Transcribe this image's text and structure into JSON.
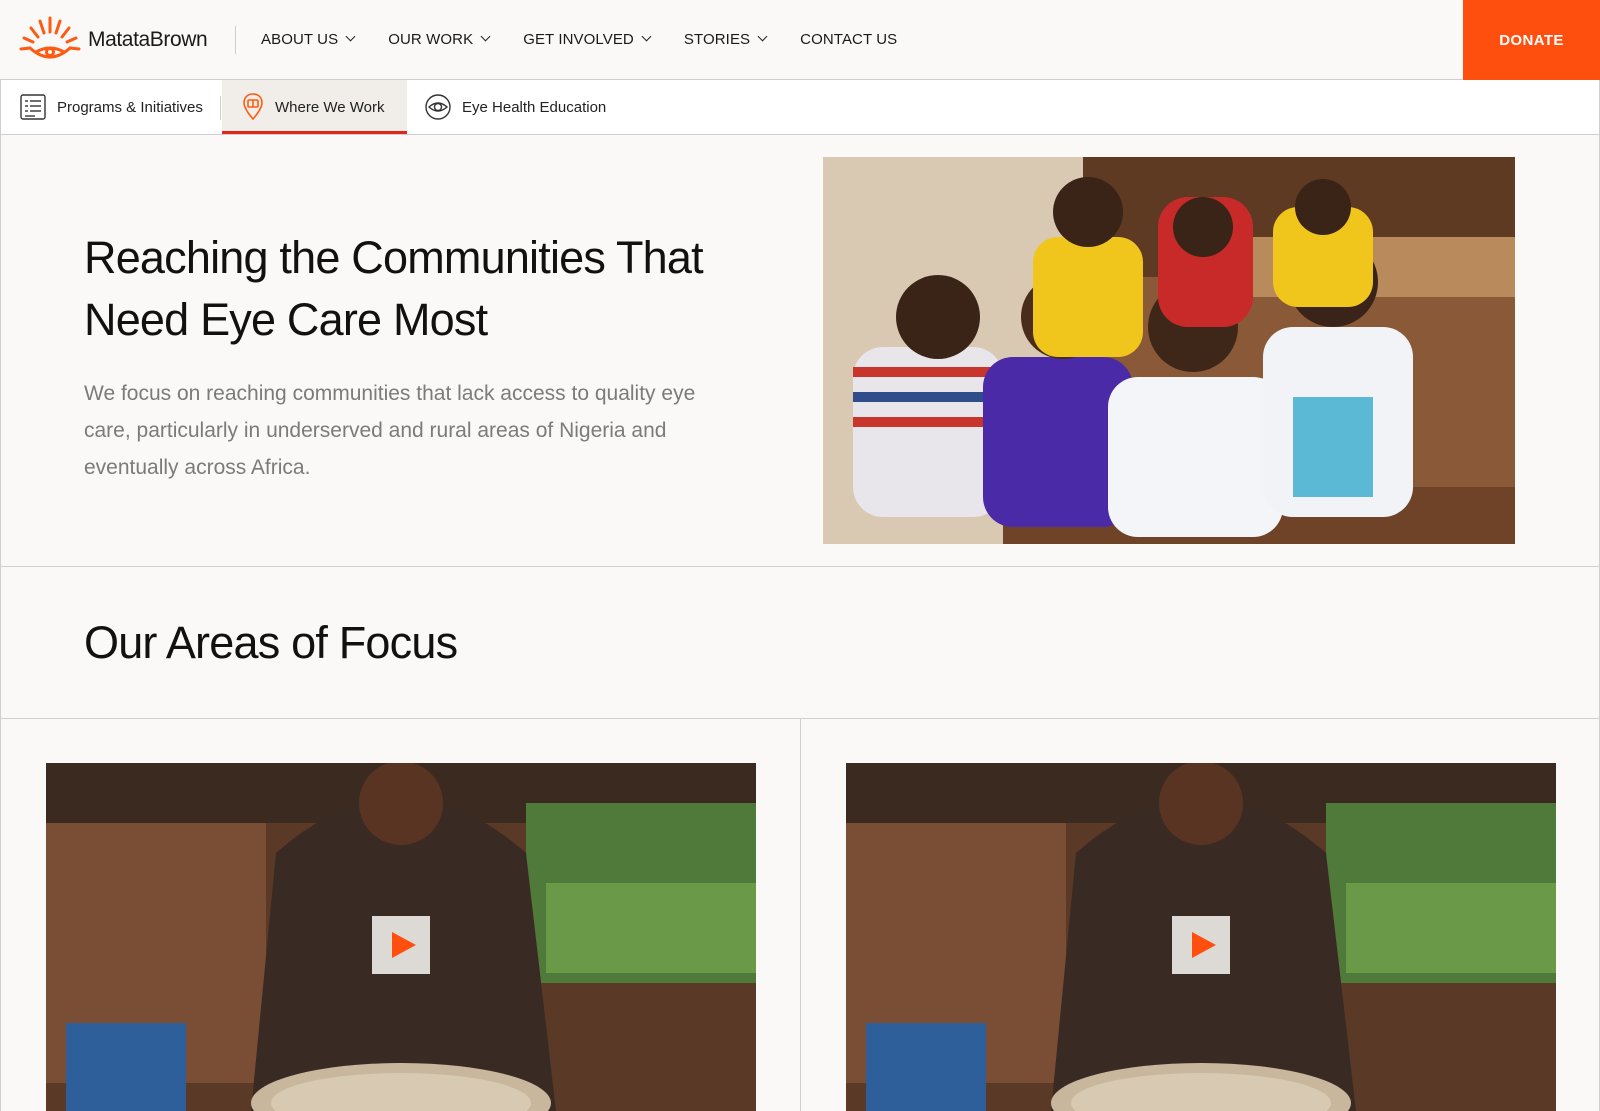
{
  "brand": {
    "name": "MatataBrown",
    "logo_icon": "sun-eye-logo",
    "accent": "#ff4f0f"
  },
  "nav": {
    "items": [
      {
        "label": "ABOUT US",
        "dropdown": true
      },
      {
        "label": "OUR WORK",
        "dropdown": true
      },
      {
        "label": "GET INVOLVED",
        "dropdown": true
      },
      {
        "label": "STORIES",
        "dropdown": true
      },
      {
        "label": "CONTACT US",
        "dropdown": false
      }
    ],
    "donate_label": "DONATE"
  },
  "subnav": {
    "tabs": [
      {
        "label": "Programs & Initiatives",
        "icon": "list-document-icon"
      },
      {
        "label": "Where We Work",
        "icon": "map-pin-icon",
        "active": true
      },
      {
        "label": "Eye Health Education",
        "icon": "eye-icon"
      }
    ]
  },
  "hero": {
    "title": "Reaching the Communities That Need Eye Care Most",
    "description": "We focus on reaching communities that lack access to quality eye care, particularly in underserved and rural areas of Nigeria and eventually across Africa."
  },
  "areas": {
    "title": "Our Areas of Focus",
    "cards": [
      {
        "media": "video",
        "icon": "play-icon"
      },
      {
        "media": "video",
        "icon": "play-icon"
      }
    ]
  },
  "colors": {
    "accent": "#ff4f0f",
    "active_underline": "#e3261b",
    "background": "#faf9f7"
  }
}
